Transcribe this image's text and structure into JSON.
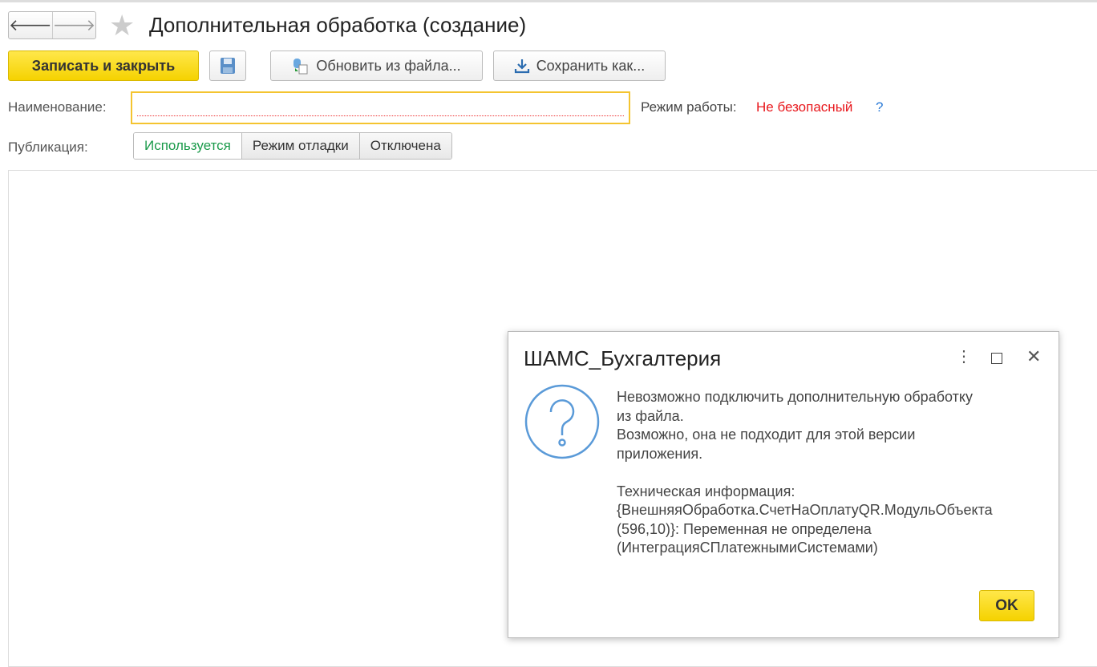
{
  "window": {
    "title": "Дополнительная обработка (создание)"
  },
  "toolbar": {
    "save_close": "Записать и закрыть",
    "update_from_file": "Обновить из файла...",
    "save_as": "Сохранить как..."
  },
  "form": {
    "name_label": "Наименование:",
    "name_value": "",
    "mode_label": "Режим работы:",
    "mode_value": "Не безопасный",
    "help": "?",
    "publication_label": "Публикация:",
    "publication_options": [
      "Используется",
      "Режим отладки",
      "Отключена"
    ],
    "publication_selected": "Используется"
  },
  "dialog": {
    "title": "ШАМС_Бухгалтерия",
    "message": "Невозможно подключить дополнительную обработку\nиз файла.\nВозможно, она не подходит для этой версии\nприложения.\n\nТехническая информация:\n{ВнешняяОбработка.СчетНаОплатуQR.МодульОбъекта\n(596,10)}: Переменная не определена\n(ИнтеграцияСПлатежнымиСистемами)",
    "ok": "OK"
  }
}
